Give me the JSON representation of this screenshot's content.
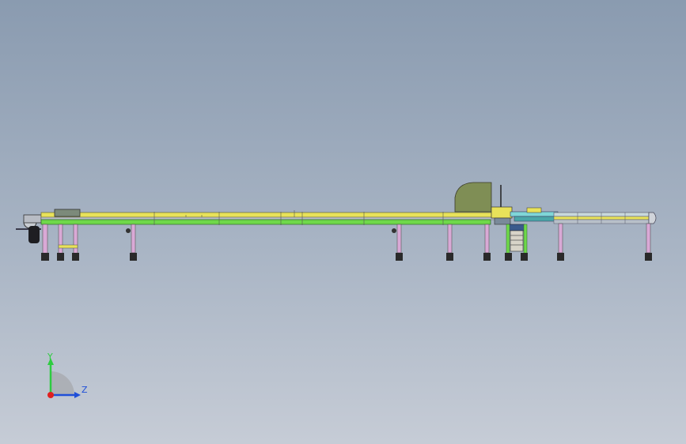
{
  "viewport": {
    "background_top": "#8a9bb0",
    "background_bottom": "#c6ccd6"
  },
  "model": {
    "colors": {
      "rail_yellow": "#e8e25a",
      "rail_green": "#6fd84a",
      "frame_gray": "#9aa0a8",
      "leg_pink": "#d9a9d6",
      "foot_dark": "#2a2a2a",
      "saw_guard": "#7f8e55",
      "outfeed_cyan": "#7fd6d8",
      "drive_blue": "#3a5a8c"
    }
  },
  "triad": {
    "y_label": "Y",
    "z_label": "Z",
    "y_color": "#2ecc40",
    "z_color": "#1f4fd8",
    "x_color": "#e02020"
  }
}
